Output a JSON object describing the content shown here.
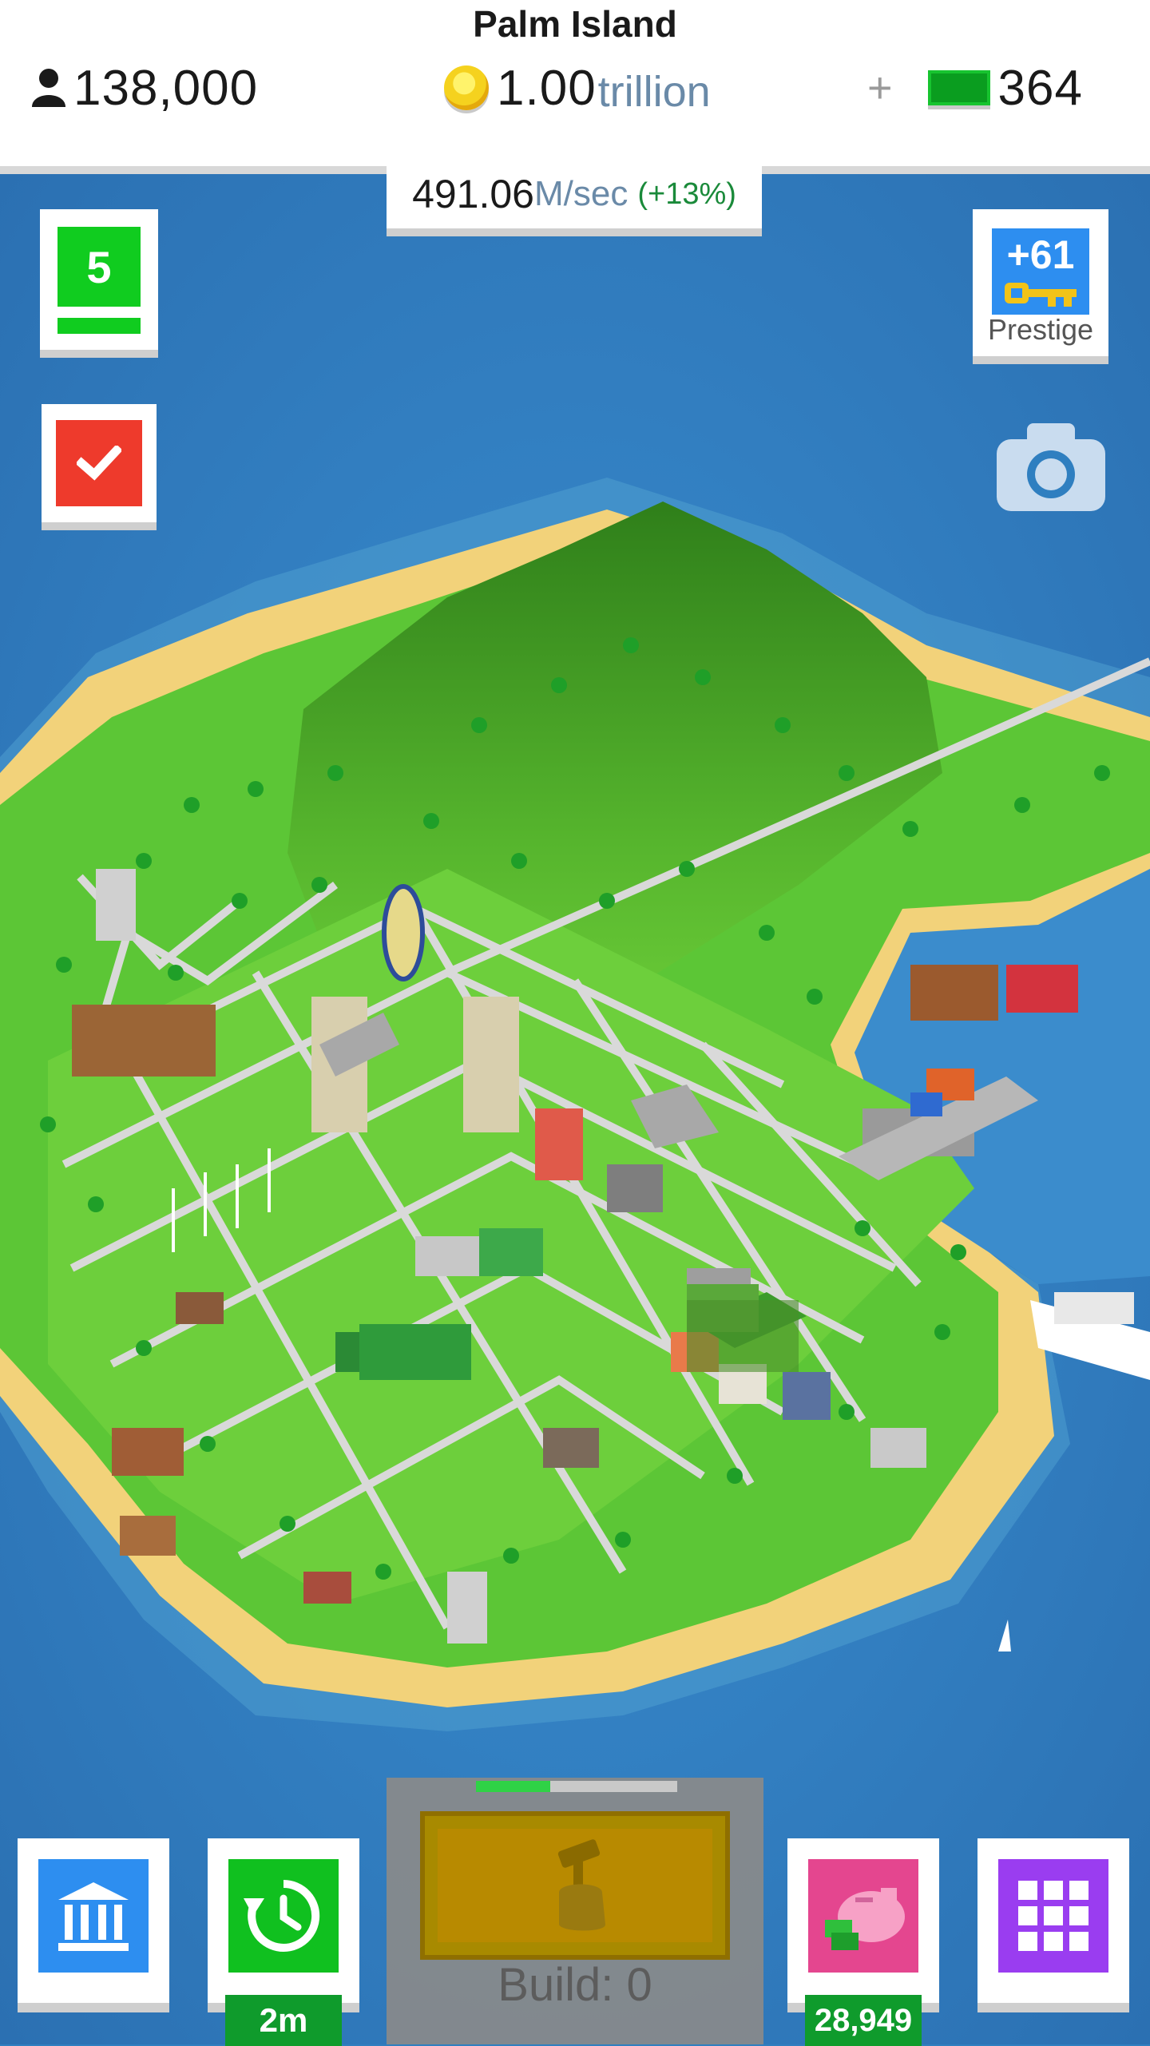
{
  "header": {
    "island_name": "Palm Island",
    "population": "138,000",
    "coins": "1.00",
    "coins_unit": "trillion",
    "gems_plus": "+",
    "gems": "364"
  },
  "income": {
    "value": "491.06",
    "unit": "M/sec",
    "bonus": "(+13%)"
  },
  "side_buttons": {
    "level": "5",
    "prestige_count": "+61",
    "prestige_label": "Prestige"
  },
  "bottom_bar": {
    "timer_label": "2m",
    "shop_count": "28,949",
    "build_label": "Build: 0",
    "build_progress": 0.37
  },
  "icons": {
    "population": "person-icon",
    "coins": "coin-icon",
    "gems": "gem-bar-icon",
    "level": "level-badge-icon",
    "tasks": "checkmark-icon",
    "prestige": "key-icon",
    "camera": "camera-icon",
    "bank": "bank-icon",
    "time": "clock-refresh-icon",
    "build": "hammer-hand-icon",
    "shop": "piggy-bank-icon",
    "menu": "grid-icon"
  },
  "colors": {
    "ocean": "#2f7fc0",
    "land": "#5cc636",
    "mountain": "#3d9a24",
    "sand": "#f2d27a",
    "level_green": "#10cc1f",
    "tasks_red": "#ee3a2c",
    "prestige_blue": "#2d8ef0",
    "bank_blue": "#2d8ef0",
    "time_green": "#10c01f",
    "shop_pink": "#e4468f",
    "menu_purple": "#9a3df0",
    "build_gold": "#b88a00"
  }
}
